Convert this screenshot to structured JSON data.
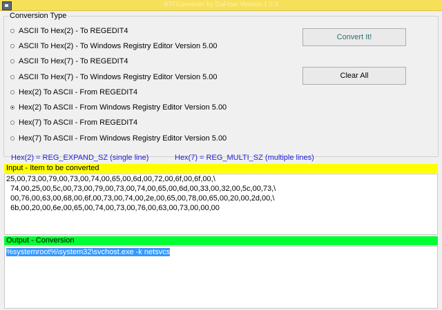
{
  "window": {
    "title": "RTFConverter by DaFiner Version 1.0.3"
  },
  "conversion_group": {
    "title": "Conversion Type",
    "options": [
      {
        "label": "ASCII To Hex(2) - To REGEDIT4",
        "selected": false
      },
      {
        "label": "ASCII To Hex(2) - To Windows Registry Editor Version 5.00",
        "selected": false
      },
      {
        "label": "ASCII To Hex(7) - To REGEDIT4",
        "selected": false
      },
      {
        "label": "ASCII To Hex(7) - To Windows Registry Editor Version 5.00",
        "selected": false
      },
      {
        "label": "Hex(2) To ASCII - From REGEDIT4",
        "selected": false
      },
      {
        "label": "Hex(2) To ASCII - From Windows Registry Editor Version 5.00",
        "selected": true
      },
      {
        "label": "Hex(7) To ASCII - From REGEDIT4",
        "selected": false
      },
      {
        "label": "Hex(7) To ASCII - From Windows Registry Editor Version 5.00",
        "selected": false
      }
    ]
  },
  "buttons": {
    "convert": "Convert It!",
    "clear": "Clear All"
  },
  "legend": {
    "hex2": "Hex(2) = REG_EXPAND_SZ (single line)",
    "hex7": "Hex(7) = REG_MULTI_SZ (multiple lines)"
  },
  "input": {
    "header": "Input - Item to be converted",
    "lines": [
      "25,00,73,00,79,00,73,00,74,00,65,00,6d,00,72,00,6f,00,6f,00,\\",
      "  74,00,25,00,5c,00,73,00,79,00,73,00,74,00,65,00,6d,00,33,00,32,00,5c,00,73,\\",
      "  00,76,00,63,00,68,00,6f,00,73,00,74,00,2e,00,65,00,78,00,65,00,20,00,2d,00,\\",
      "  6b,00,20,00,6e,00,65,00,74,00,73,00,76,00,63,00,73,00,00,00"
    ]
  },
  "output": {
    "header": "Output - Conversion",
    "value": "%systemroot%\\system32\\svchost.exe -k netsvcs"
  },
  "colors": {
    "input_header_bg": "#ffff00",
    "output_header_bg": "#00ff33",
    "legend_text": "#2222dd",
    "selection": "#3399ff"
  }
}
